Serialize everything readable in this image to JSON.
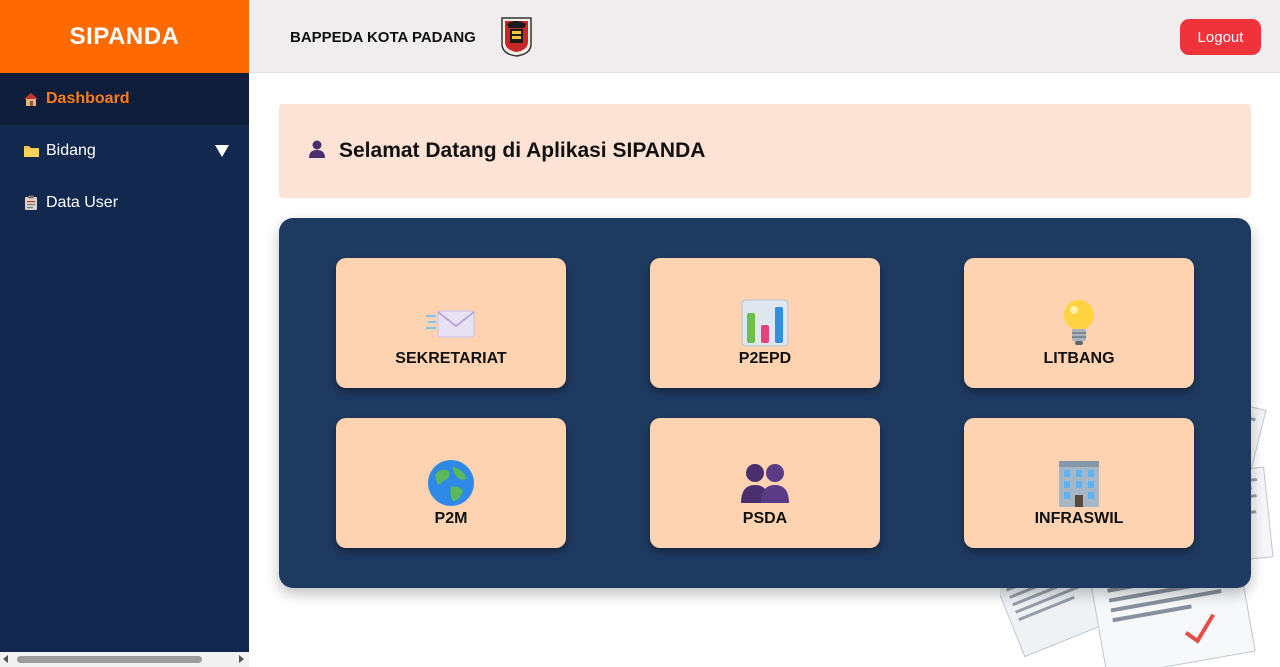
{
  "app": {
    "brand": "SIPANDA"
  },
  "header": {
    "org_name": "BAPPEDA KOTA PADANG",
    "logout_label": "Logout"
  },
  "sidebar": {
    "items": [
      {
        "label": "Dashboard",
        "icon": "house-icon",
        "active": true
      },
      {
        "label": "Bidang",
        "icon": "folder-icon",
        "expandable": true
      },
      {
        "label": "Data User",
        "icon": "clipboard-icon"
      }
    ]
  },
  "welcome": {
    "title": "Selamat Datang di Aplikasi SIPANDA",
    "icon": "user-icon"
  },
  "cards": [
    {
      "label": "SEKRETARIAT",
      "icon": "envelope-icon"
    },
    {
      "label": "P2EPD",
      "icon": "bar-chart-icon"
    },
    {
      "label": "LITBANG",
      "icon": "lightbulb-icon"
    },
    {
      "label": "P2M",
      "icon": "globe-icon"
    },
    {
      "label": "PSDA",
      "icon": "people-icon"
    },
    {
      "label": "INFRASWIL",
      "icon": "building-icon"
    }
  ],
  "colors": {
    "brand": "#ff6a00",
    "sidebar": "#13284f",
    "active_text": "#ff7a1a",
    "panel": "#1f3a61",
    "card": "#fdd3b1",
    "welcome_bg": "#fde3d5",
    "logout": "#f0333a"
  }
}
